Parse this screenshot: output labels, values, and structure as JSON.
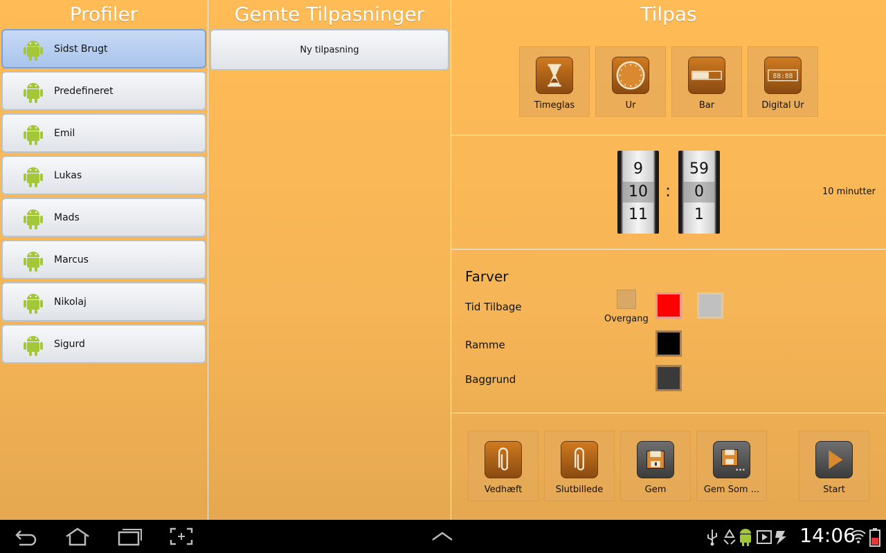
{
  "columns": {
    "profiles_title": "Profiler",
    "saved_title": "Gemte Tilpasninger",
    "custom_title": "Tilpas"
  },
  "profiles": [
    {
      "name": "Sidst Brugt",
      "selected": true
    },
    {
      "name": "Predefineret",
      "selected": false
    },
    {
      "name": "Emil",
      "selected": false
    },
    {
      "name": "Lukas",
      "selected": false
    },
    {
      "name": "Mads",
      "selected": false
    },
    {
      "name": "Marcus",
      "selected": false
    },
    {
      "name": "Nikolaj",
      "selected": false
    },
    {
      "name": "Sigurd",
      "selected": false
    }
  ],
  "saved": {
    "new_label": "Ny tilpasning"
  },
  "timer_types": [
    {
      "label": "Timeglas",
      "icon": "hourglass-icon"
    },
    {
      "label": "Ur",
      "icon": "clock-icon"
    },
    {
      "label": "Bar",
      "icon": "progress-bar-icon"
    },
    {
      "label": "Digital Ur",
      "icon": "digital-clock-icon"
    }
  ],
  "time_picker": {
    "minutes": {
      "prev": "9",
      "current": "10",
      "next": "11"
    },
    "seconds": {
      "prev": "59",
      "current": "0",
      "next": "1"
    },
    "separator": ":",
    "duration_text": "10 minutter"
  },
  "colors": {
    "title": "Farver",
    "time_left_label": "Tid Tilbage",
    "transition_label": "Overgang",
    "frame_label": "Ramme",
    "background_label": "Baggrund",
    "time_left_color": "#ff0000",
    "time_left_alt_color": "#c0c0c0",
    "frame_color": "#000000",
    "background_color": "#3a3a3a"
  },
  "actions": [
    {
      "label": "Vedhæft",
      "icon": "paperclip-icon"
    },
    {
      "label": "Slutbillede",
      "icon": "paperclip-icon"
    },
    {
      "label": "Gem",
      "icon": "floppy-disk-icon"
    },
    {
      "label": "Gem Som ...",
      "icon": "floppy-disk-save-as-icon"
    },
    {
      "label": "Start",
      "icon": "play-icon"
    }
  ],
  "status_bar": {
    "time": "14:06"
  }
}
